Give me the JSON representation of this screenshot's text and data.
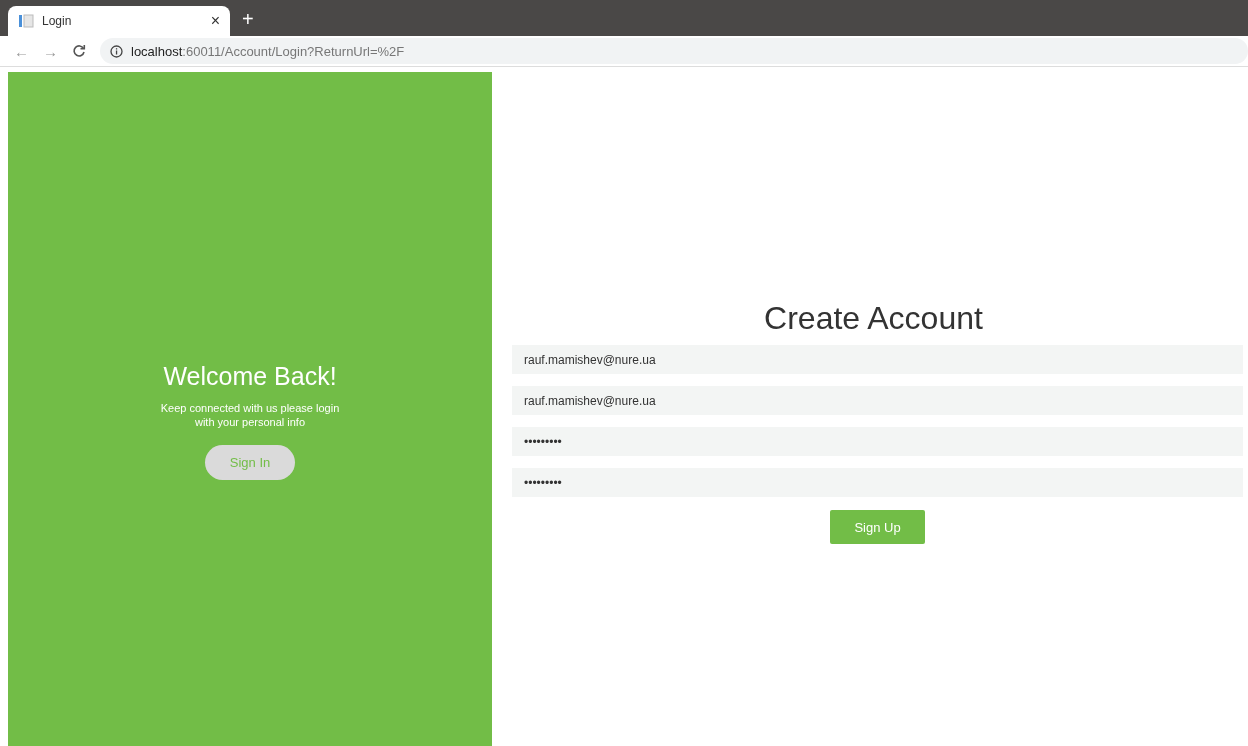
{
  "browser": {
    "tab": {
      "title": "Login",
      "close": "×"
    },
    "new_tab": "+",
    "nav": {
      "back": "←",
      "forward": "→"
    },
    "address": {
      "host": "localhost",
      "path": ":60011/Account/Login?ReturnUrl=%2F"
    }
  },
  "welcome": {
    "title": "Welcome Back!",
    "text": "Keep connected with us please login with your personal info",
    "button": "Sign In"
  },
  "signup": {
    "title": "Create Account",
    "fields": [
      {
        "value": "rauf.mamishev@nure.ua"
      },
      {
        "value": "rauf.mamishev@nure.ua"
      },
      {
        "value": "•••••••••"
      },
      {
        "value": "•••••••••"
      }
    ],
    "button": "Sign Up"
  }
}
